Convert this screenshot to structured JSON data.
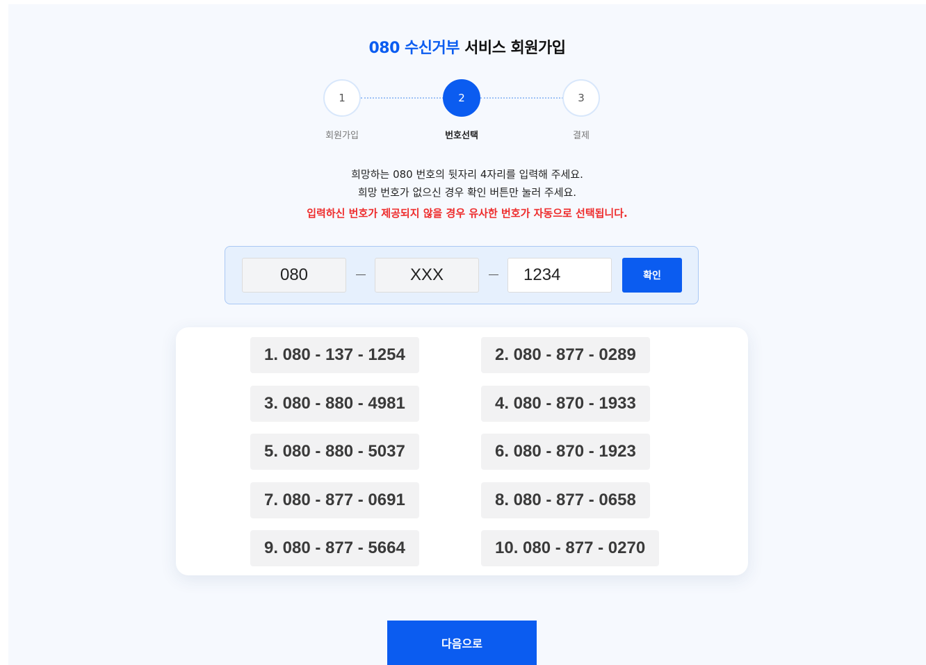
{
  "header": {
    "title_accent": "080 수신거부",
    "title_rest": " 서비스 회원가입"
  },
  "stepper": {
    "current_step": 2,
    "steps": [
      {
        "number": "1",
        "label": "회원가입"
      },
      {
        "number": "2",
        "label": "번호선택"
      },
      {
        "number": "3",
        "label": "결제"
      }
    ]
  },
  "instructions": {
    "line1": "희망하는 080 번호의 뒷자리 4자리를 입력해 주세요.",
    "line2": "희망 번호가 없으신 경우 확인 버튼만 눌러 주세요.",
    "warning": "입력하신 번호가 제공되지 않을 경우 유사한 번호가 자동으로 선택됩니다."
  },
  "number_input": {
    "prefix": "080",
    "middle": "XXX",
    "last_value": "1234",
    "confirm_label": "확인"
  },
  "suggestions": [
    "1. 080 - 137 - 1254",
    "2. 080 - 877 - 0289",
    "3. 080 - 880 - 4981",
    "4. 080 - 870 - 1933",
    "5. 080 - 880 - 5037",
    "6. 080 - 870 - 1923",
    "7. 080 - 877 - 0691",
    "8. 080 - 877 - 0658",
    "9. 080 - 877 - 5664",
    "10. 080 - 877 - 0270"
  ],
  "footer": {
    "next_label": "다음으로"
  },
  "colors": {
    "accent": "#0b5cf0",
    "warning": "#ee2b2b",
    "page_bg": "#f6f9fe"
  }
}
